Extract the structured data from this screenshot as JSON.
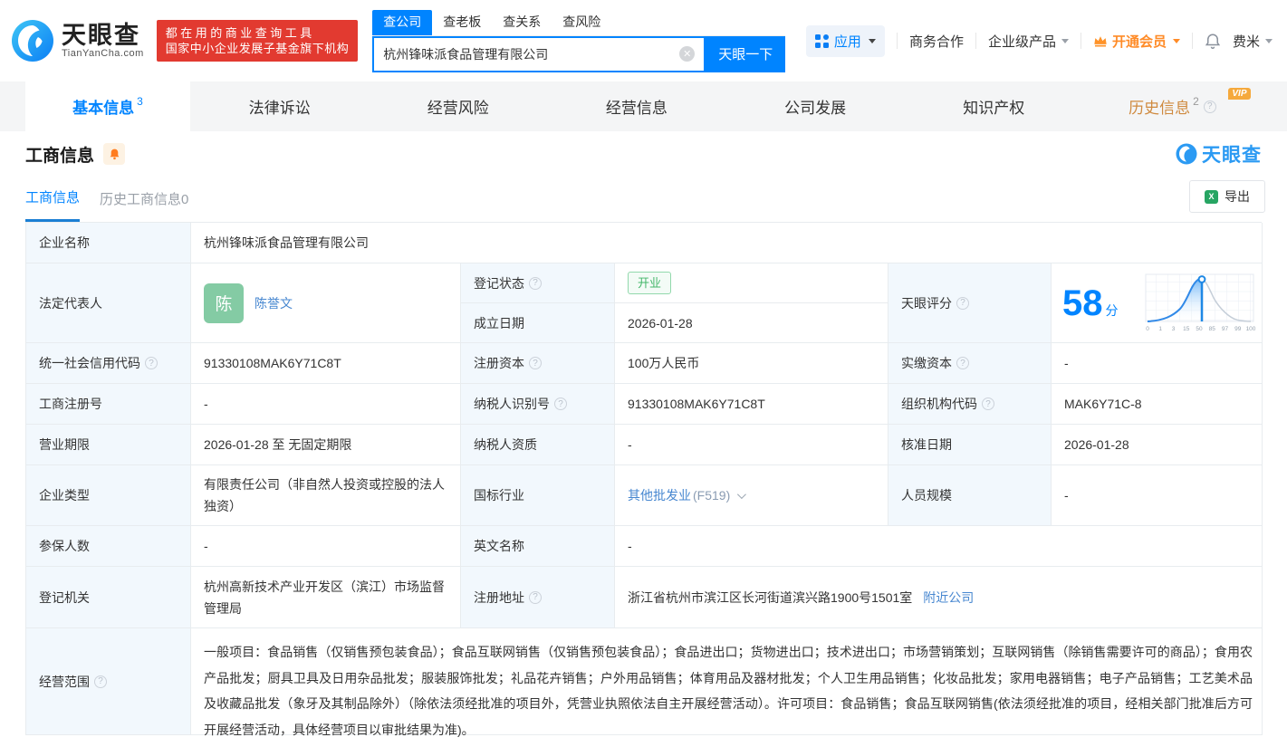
{
  "brand": {
    "name": "天眼查",
    "domain": "TianYanCha.com",
    "slogan_line1": "都在用的商业查询工具",
    "slogan_line2": "国家中小企业发展子基金旗下机构"
  },
  "search": {
    "tabs": [
      {
        "label": "查公司"
      },
      {
        "label": "查老板"
      },
      {
        "label": "查关系"
      },
      {
        "label": "查风险"
      }
    ],
    "value": "杭州锋味派食品管理有限公司",
    "button": "天眼一下"
  },
  "topnav": {
    "apps": "应用",
    "cooperation": "商务合作",
    "enterprise": "企业级产品",
    "vip": "开通会员",
    "username": "费米"
  },
  "tabs": [
    {
      "label": "基本信息",
      "count": "3"
    },
    {
      "label": "法律诉讼",
      "count": ""
    },
    {
      "label": "经营风险",
      "count": ""
    },
    {
      "label": "经营信息",
      "count": ""
    },
    {
      "label": "公司发展",
      "count": ""
    },
    {
      "label": "知识产权",
      "count": ""
    },
    {
      "label": "历史信息",
      "count": "2",
      "badge": "VIP"
    }
  ],
  "section": {
    "title": "工商信息",
    "watermark": "天眼查"
  },
  "subtabs": {
    "current": "工商信息",
    "history": "历史工商信息0",
    "export": "导出"
  },
  "info": {
    "company_name": {
      "label": "企业名称",
      "value": "杭州锋味派食品管理有限公司"
    },
    "legal_rep": {
      "label": "法定代表人",
      "avatar": "陈",
      "name": "陈誉文"
    },
    "reg_status": {
      "label": "登记状态",
      "value": "开业"
    },
    "establish_date": {
      "label": "成立日期",
      "value": "2026-01-28"
    },
    "score": {
      "label": "天眼评分",
      "value": "58",
      "unit": "分",
      "axis": [
        "0",
        "1",
        "3",
        "15",
        "50",
        "85",
        "97",
        "99",
        "100"
      ]
    },
    "credit_code": {
      "label": "统一社会信用代码",
      "value": "91330108MAK6Y71C8T"
    },
    "reg_capital": {
      "label": "注册资本",
      "value": "100万人民币"
    },
    "paid_capital": {
      "label": "实缴资本",
      "value": "-"
    },
    "reg_number": {
      "label": "工商注册号",
      "value": "-"
    },
    "taxpayer_id": {
      "label": "纳税人识别号",
      "value": "91330108MAK6Y71C8T"
    },
    "org_code": {
      "label": "组织机构代码",
      "value": "MAK6Y71C-8"
    },
    "business_term": {
      "label": "营业期限",
      "value": "2026-01-28 至 无固定期限"
    },
    "taxpayer_quality": {
      "label": "纳税人资质",
      "value": "-"
    },
    "approval_date": {
      "label": "核准日期",
      "value": "2026-01-28"
    },
    "company_type": {
      "label": "企业类型",
      "value": "有限责任公司（非自然人投资或控股的法人独资）"
    },
    "industry": {
      "label": "国标行业",
      "link": "其他批发业",
      "code": "(F519)"
    },
    "staff_size": {
      "label": "人员规模",
      "value": "-"
    },
    "insured_count": {
      "label": "参保人数",
      "value": "-"
    },
    "english_name": {
      "label": "英文名称",
      "value": "-"
    },
    "reg_authority": {
      "label": "登记机关",
      "value": "杭州高新技术产业开发区（滨江）市场监督管理局"
    },
    "reg_address": {
      "label": "注册地址",
      "value": "浙江省杭州市滨江区长河街道滨兴路1900号1501室",
      "link": "附近公司"
    },
    "business_scope": {
      "label": "经营范围",
      "value": "一般项目：食品销售（仅销售预包装食品）；食品互联网销售（仅销售预包装食品）；食品进出口；货物进出口；技术进出口；市场营销策划；互联网销售（除销售需要许可的商品）；食用农产品批发；厨具卫具及日用杂品批发；服装服饰批发；礼品花卉销售；户外用品销售；体育用品及器材批发；个人卫生用品销售；化妆品批发；家用电器销售；电子产品销售；工艺美术品及收藏品批发（象牙及其制品除外）（除依法须经批准的项目外，凭营业执照依法自主开展经营活动）。许可项目：食品销售；食品互联网销售(依法须经批准的项目，经相关部门批准后方可开展经营活动，具体经营项目以审批结果为准)。"
    }
  },
  "colors": {
    "brand_blue": "#0084ff",
    "link_blue": "#4787d0",
    "banner_red": "#e23a30",
    "vip_orange": "#ff8b27",
    "status_green": "#44b76a"
  }
}
